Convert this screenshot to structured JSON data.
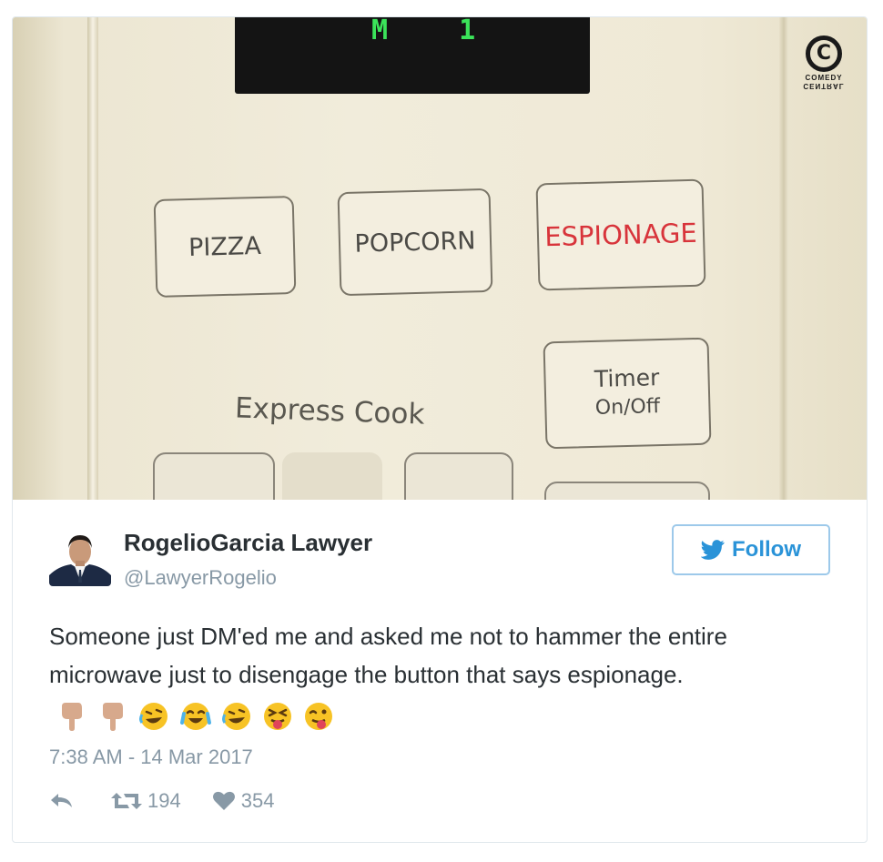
{
  "photo": {
    "display_text": "M  1",
    "buttons": {
      "pizza": "PIZZA",
      "popcorn": "POPCORN",
      "espionage": "ESPIONAGE",
      "timer_line1": "Timer",
      "timer_line2": "On/Off"
    },
    "express_cook": "Express Cook",
    "watermark": {
      "letter": "C",
      "text_line1": "COMEDY",
      "text_line2": "CENTRAL"
    },
    "colors": {
      "espionage": "#d8343b",
      "display_digits": "#3be45a"
    }
  },
  "tweet": {
    "author_name": "RogelioGarcia Lawyer",
    "handle": "@LawyerRogelio",
    "follow_label": "Follow",
    "text": "Someone just DM'ed me and asked me not to hammer the entire microwave just to disengage the button that says espionage.",
    "emojis": [
      "point-down-emoji",
      "point-down-emoji",
      "rofl-emoji",
      "joy-emoji",
      "rofl-emoji",
      "squinting-tongue-emoji",
      "winking-tongue-emoji"
    ],
    "timestamp": "7:38 AM - 14 Mar 2017",
    "retweets": "194",
    "likes": "354",
    "colors": {
      "follow": "#2a93d8",
      "muted": "#8899a6",
      "text": "#292f33"
    }
  }
}
